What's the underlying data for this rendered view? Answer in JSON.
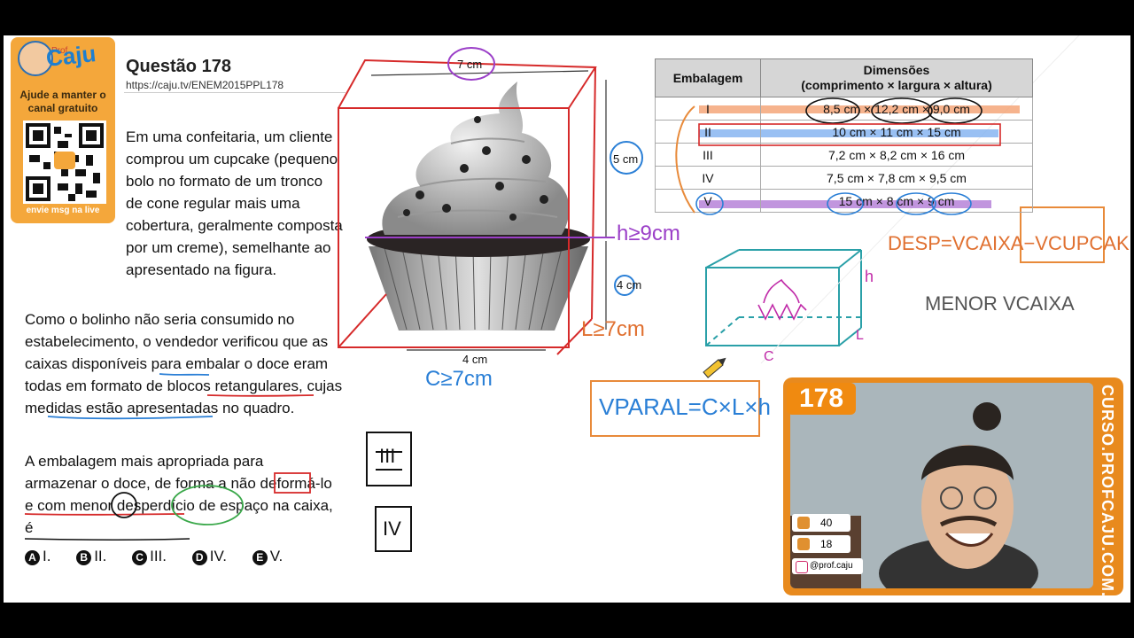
{
  "sidebar": {
    "brand": "Caju",
    "brand_prefix": "Prof.",
    "help_text": "Ajude a manter o canal gratuito",
    "cta": "envie msg na live"
  },
  "question": {
    "title": "Questão 178",
    "url": "https://caju.tv/ENEM2015PPL178",
    "p1": "Em uma confeitaria, um cliente comprou um cupcake (pequeno bolo no formato de um tronco de cone regular mais uma cobertura, geralmente composta por um creme), semelhante ao apresentado na figura.",
    "p2": "Como o bolinho não seria consumido no estabelecimento, o vendedor verificou que as caixas disponíveis para embalar o doce eram todas em formato de blocos retangulares, cujas medidas estão apresentadas no quadro.",
    "p3": "A embalagem mais apropriada para armazenar o doce, de forma a não deformá-lo e com menor desperdício de espaço na caixa, é",
    "options": [
      {
        "letter": "A",
        "text": "I."
      },
      {
        "letter": "B",
        "text": "II."
      },
      {
        "letter": "C",
        "text": "III."
      },
      {
        "letter": "D",
        "text": "IV."
      },
      {
        "letter": "E",
        "text": "V."
      }
    ]
  },
  "figure": {
    "top_label": "7 cm",
    "height_label": "5 cm",
    "base_height_label": "4 cm",
    "bottom_label": "4 cm"
  },
  "table": {
    "header_col1": "Embalagem",
    "header_col2_line1": "Dimensões",
    "header_col2_line2": "(comprimento × largura × altura)",
    "rows": [
      {
        "id": "I",
        "dims": "8,5 cm × 12,2 cm × 9,0 cm"
      },
      {
        "id": "II",
        "dims": "10 cm × 11 cm × 15 cm"
      },
      {
        "id": "III",
        "dims": "7,2 cm × 8,2 cm × 16 cm"
      },
      {
        "id": "IV",
        "dims": "7,5 cm × 7,8 cm × 9,5 cm"
      },
      {
        "id": "V",
        "dims": "15 cm × 8 cm × 9 cm"
      }
    ]
  },
  "annotations": {
    "h_rule": "h≥9cm",
    "l_rule": "L≥7cm",
    "c_rule": "C≥7cm",
    "volume_formula": "VPARAL=C×L×h",
    "desp_formula": "DESP=VCAIXA−VCUPCAKE",
    "menor": "MENOR VCAIXA",
    "box_h": "h",
    "box_l": "L",
    "box_c": "C",
    "mark1": "III",
    "mark2": "IV"
  },
  "webcam": {
    "question_number": "178",
    "likes": "40",
    "comments": "18",
    "handle": "@prof.caju",
    "side_text": "CURSO.PROFCAJU.COM.BR"
  },
  "colors": {
    "accent_orange": "#f08a10",
    "ink_red": "#d62a2a",
    "ink_blue": "#2a7fd6",
    "ink_purple": "#9b3fc8",
    "ink_green": "#3aa84a",
    "highlight_orange": "#f4a070",
    "highlight_blue": "#7fb0f0",
    "highlight_purple": "#b27bd6"
  }
}
